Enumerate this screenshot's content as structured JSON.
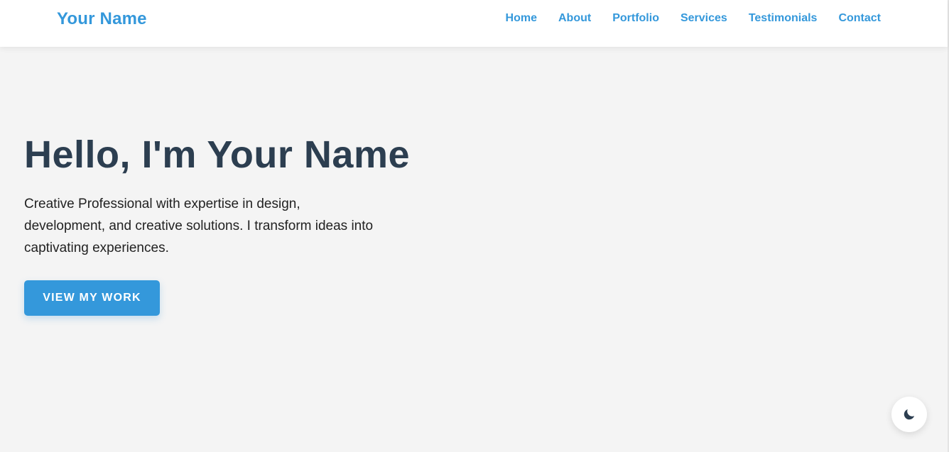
{
  "colors": {
    "accent": "#3498db",
    "heading": "#2c3e50",
    "page_bg": "#f4f4f4",
    "header_bg": "#ffffff"
  },
  "header": {
    "brand": "Your Name",
    "nav": [
      {
        "label": "Home"
      },
      {
        "label": "About"
      },
      {
        "label": "Portfolio"
      },
      {
        "label": "Services"
      },
      {
        "label": "Testimonials"
      },
      {
        "label": "Contact"
      }
    ]
  },
  "hero": {
    "title": "Hello, I'm Your Name",
    "text": "Creative Professional with expertise in design, development, and creative solutions. I transform ideas into captivating experiences.",
    "cta_label": "View My Work"
  },
  "theme_toggle": {
    "icon": "moon-icon"
  }
}
